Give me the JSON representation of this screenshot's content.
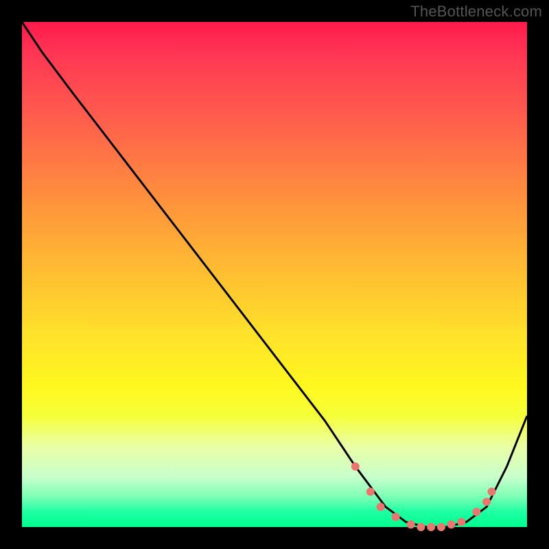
{
  "watermark": "TheBottleneck.com",
  "chart_data": {
    "type": "line",
    "title": "",
    "xlabel": "",
    "ylabel": "",
    "xlim": [
      0,
      100
    ],
    "ylim": [
      0,
      100
    ],
    "gradient_stops": [
      {
        "pos": 0,
        "color": "#ff1a4d"
      },
      {
        "pos": 18,
        "color": "#ff5a4e"
      },
      {
        "pos": 33,
        "color": "#ff8a3e"
      },
      {
        "pos": 48,
        "color": "#ffb933"
      },
      {
        "pos": 62,
        "color": "#ffe22a"
      },
      {
        "pos": 78,
        "color": "#eaffa6"
      },
      {
        "pos": 94,
        "color": "#7dffb5"
      },
      {
        "pos": 100,
        "color": "#00ff8e"
      }
    ],
    "series": [
      {
        "name": "curve",
        "color": "#000000",
        "x": [
          0,
          4,
          10,
          20,
          30,
          40,
          50,
          60,
          66,
          72,
          76,
          80,
          84,
          88,
          92,
          96,
          100
        ],
        "y": [
          100,
          94,
          86,
          73,
          60,
          47,
          34,
          21,
          12,
          4,
          1,
          0,
          0,
          1,
          4,
          12,
          22
        ]
      }
    ],
    "markers": {
      "color": "#e9766f",
      "radius": 6,
      "points": [
        {
          "x": 66,
          "y": 12
        },
        {
          "x": 69,
          "y": 7
        },
        {
          "x": 71,
          "y": 4
        },
        {
          "x": 74,
          "y": 2
        },
        {
          "x": 77,
          "y": 0.5
        },
        {
          "x": 79,
          "y": 0
        },
        {
          "x": 81,
          "y": 0
        },
        {
          "x": 83,
          "y": 0
        },
        {
          "x": 85,
          "y": 0.5
        },
        {
          "x": 87,
          "y": 1
        },
        {
          "x": 90,
          "y": 3
        },
        {
          "x": 92,
          "y": 5
        },
        {
          "x": 93,
          "y": 7
        }
      ]
    }
  }
}
